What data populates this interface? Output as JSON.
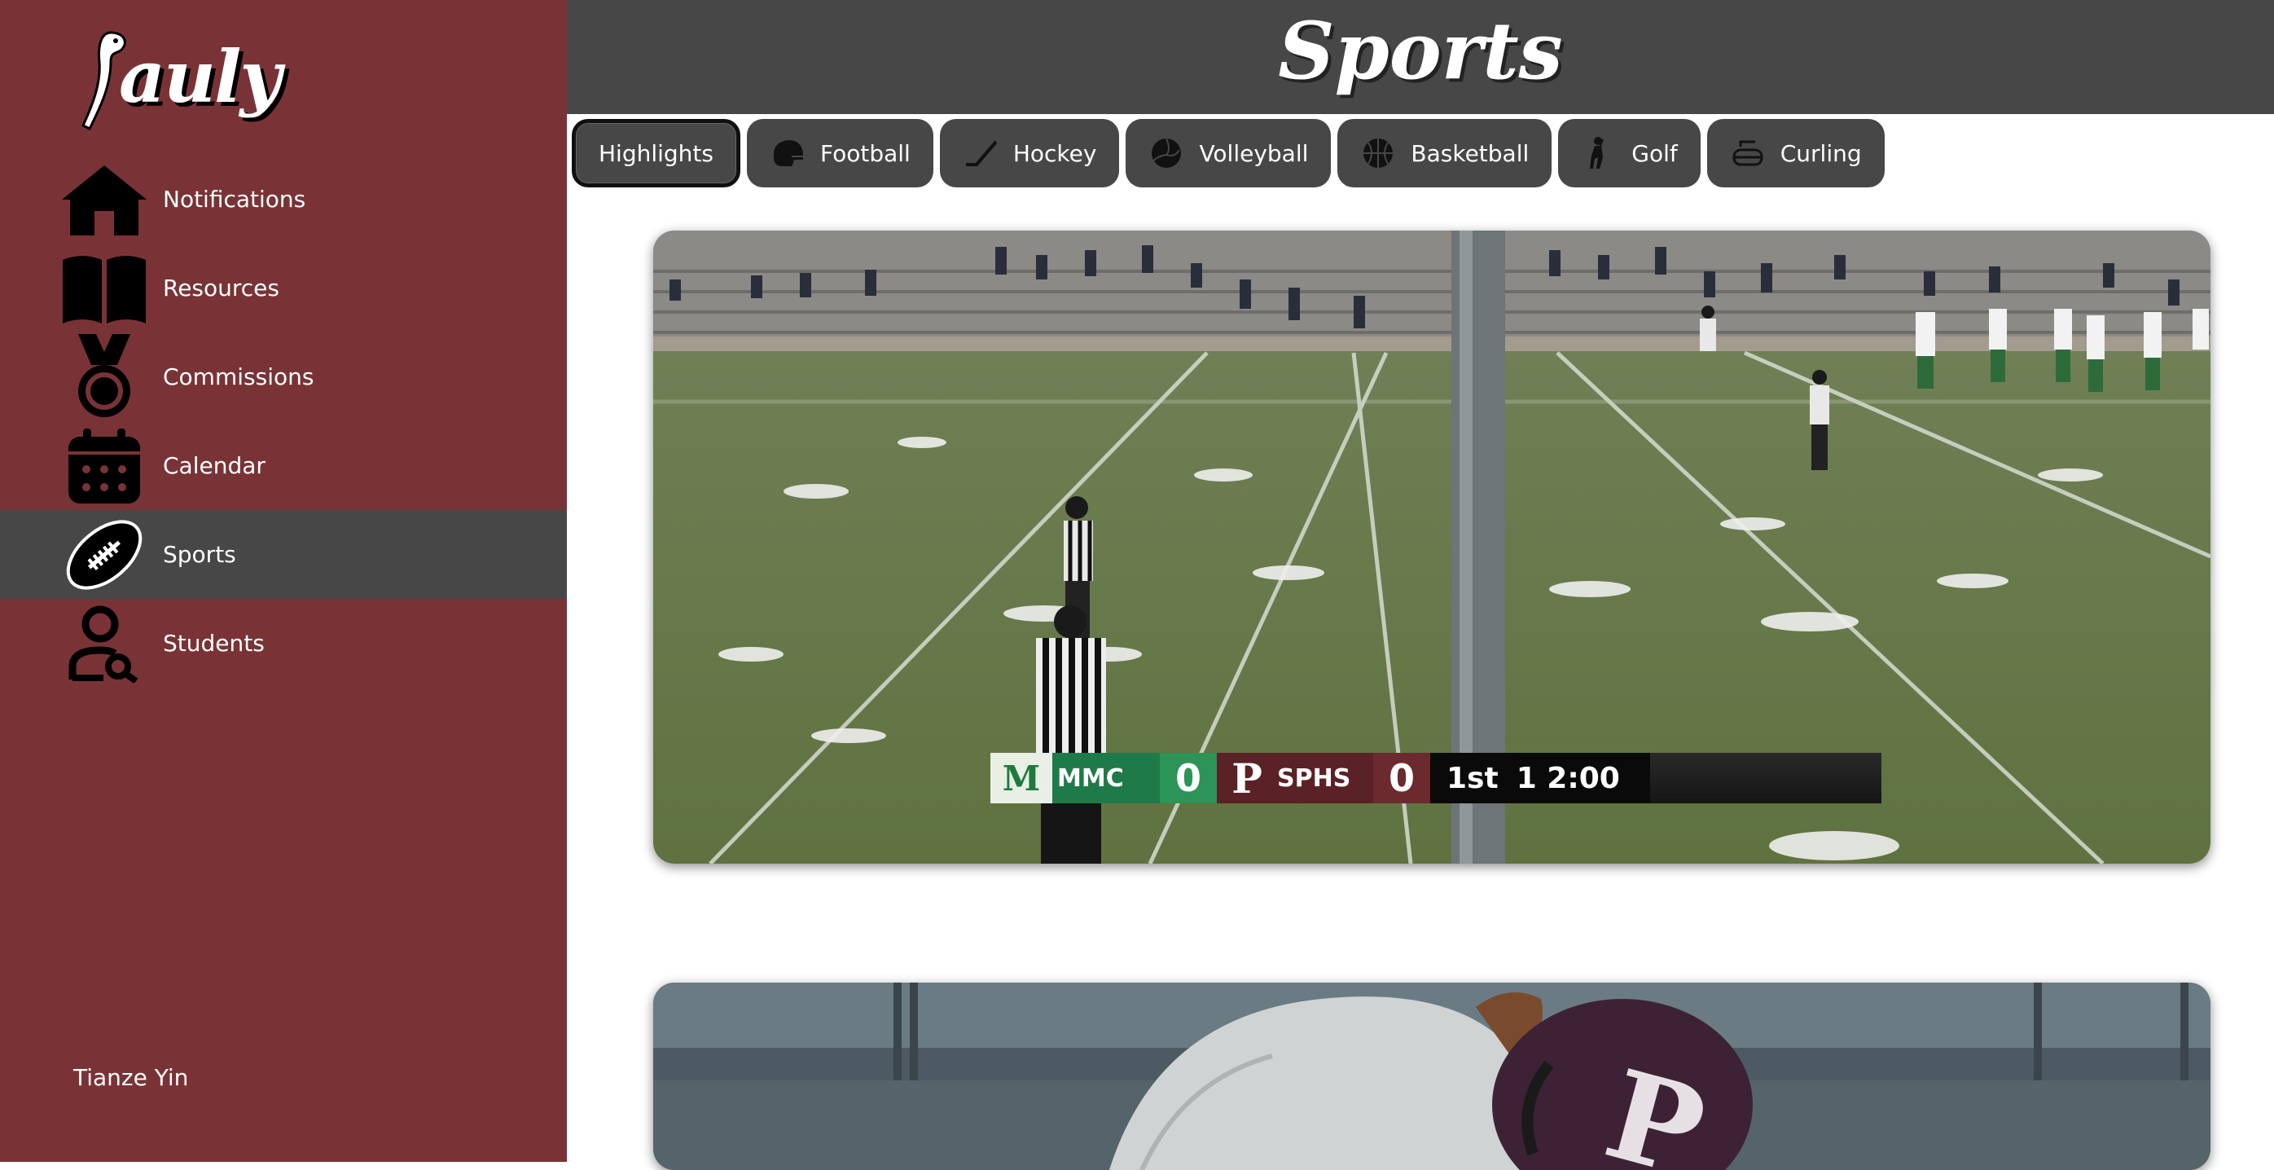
{
  "app": {
    "logo_text": "auly"
  },
  "sidebar": {
    "items": [
      {
        "label": "Notifications",
        "icon": "home-icon"
      },
      {
        "label": "Resources",
        "icon": "book-icon"
      },
      {
        "label": "Commissions",
        "icon": "medal-icon"
      },
      {
        "label": "Calendar",
        "icon": "calendar-icon"
      },
      {
        "label": "Sports",
        "icon": "football-icon",
        "active": true
      },
      {
        "label": "Students",
        "icon": "user-search-icon"
      }
    ],
    "user_name": "Tianze Yin"
  },
  "header": {
    "title": "Sports"
  },
  "tabs": [
    {
      "label": "Highlights",
      "active": true
    },
    {
      "label": "Football",
      "icon": "football-helmet-icon"
    },
    {
      "label": "Hockey",
      "icon": "hockey-stick-icon"
    },
    {
      "label": "Volleyball",
      "icon": "volleyball-icon"
    },
    {
      "label": "Basketball",
      "icon": "basketball-icon"
    },
    {
      "label": "Golf",
      "icon": "golfer-icon"
    },
    {
      "label": "Curling",
      "icon": "curling-stone-icon"
    }
  ],
  "videos": [
    {
      "scorebug": {
        "team1": "MMC",
        "score1": "0",
        "team2_logo": "P",
        "team2": "SPHS",
        "score2": "0",
        "quarter": "1st",
        "clock": "1 2:00"
      }
    },
    {}
  ],
  "colors": {
    "sidebar": "#793336",
    "header": "#474747",
    "active_item": "#474747"
  }
}
